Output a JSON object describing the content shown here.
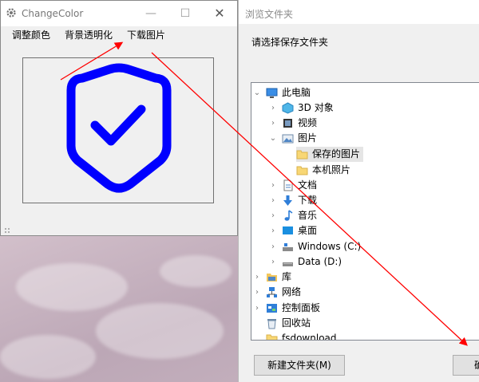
{
  "desktop": {
    "background": "pink-clouds"
  },
  "app": {
    "title": "ChangeColor",
    "icon": "gear-icon",
    "menu": [
      "调整颜色",
      "背景透明化",
      "下载图片"
    ],
    "canvas_image": "shield-check-icon",
    "shield_color": "#0000ff"
  },
  "dialog": {
    "title": "浏览文件夹",
    "prompt": "请选择保存文件夹",
    "tree": [
      {
        "label": "此电脑",
        "icon": "computer-icon",
        "expanded": true
      },
      {
        "label": "3D 对象",
        "icon": "3d-objects-icon"
      },
      {
        "label": "视频",
        "icon": "video-icon"
      },
      {
        "label": "图片",
        "icon": "pictures-icon",
        "expanded": true
      },
      {
        "label": "保存的图片",
        "icon": "folder-icon",
        "selected": true
      },
      {
        "label": "本机照片",
        "icon": "folder-icon"
      },
      {
        "label": "文档",
        "icon": "documents-icon"
      },
      {
        "label": "下载",
        "icon": "download-icon"
      },
      {
        "label": "音乐",
        "icon": "music-icon"
      },
      {
        "label": "桌面",
        "icon": "desktop-icon"
      },
      {
        "label": "Windows (C:)",
        "icon": "drive-c-icon"
      },
      {
        "label": "Data (D:)",
        "icon": "drive-d-icon"
      },
      {
        "label": "库",
        "icon": "library-icon"
      },
      {
        "label": "网络",
        "icon": "network-icon"
      },
      {
        "label": "控制面板",
        "icon": "control-panel-icon"
      },
      {
        "label": "回收站",
        "icon": "recycle-bin-icon"
      },
      {
        "label": "fsdownload",
        "icon": "folder-icon"
      }
    ],
    "new_folder_button": "新建文件夹(M)",
    "ok_button": "确"
  },
  "annotation_color": "#ff0000"
}
